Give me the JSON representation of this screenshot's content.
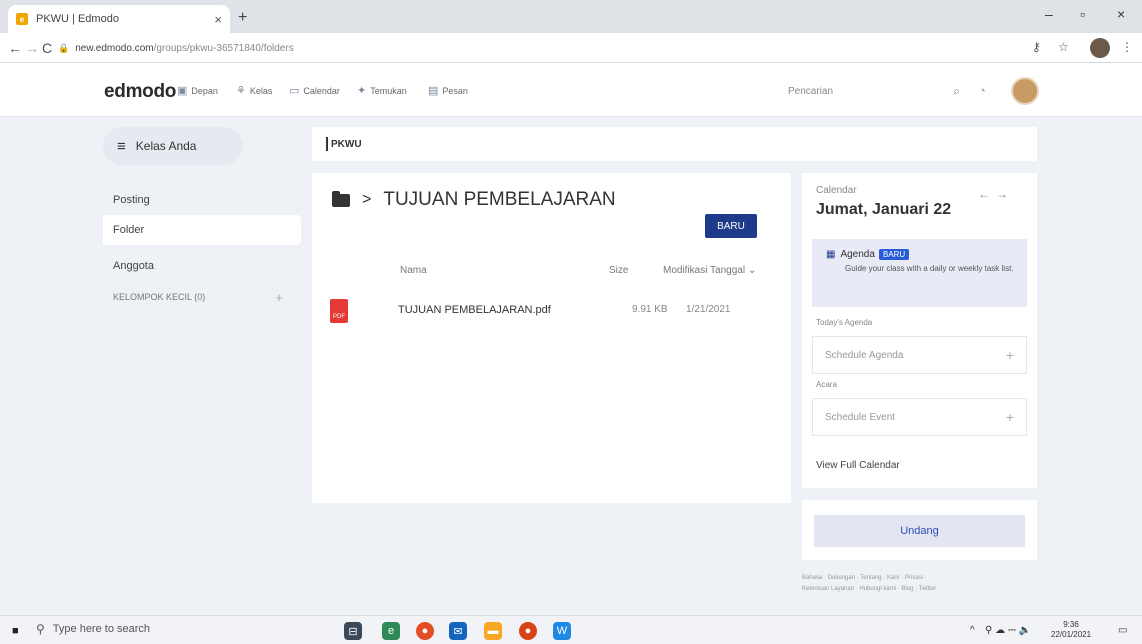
{
  "browser": {
    "tab_title": "PKWU | Edmodo",
    "tab_close": "×",
    "new_tab": "+",
    "url_host": "new.edmodo.com",
    "url_path": "/groups/pkwu-36571840/folders",
    "minimize": "–",
    "maximize": "▫",
    "close": "×",
    "back": "←",
    "forward": "→",
    "reload": "C"
  },
  "header": {
    "logo": "edmodo",
    "nav": [
      {
        "label": "Depan",
        "icon": "home-icon"
      },
      {
        "label": "Kelas",
        "icon": "class-icon"
      },
      {
        "label": "Calendar",
        "icon": "calendar-icon"
      },
      {
        "label": "Temukan",
        "icon": "discover-icon"
      },
      {
        "label": "Pesan",
        "icon": "message-icon"
      }
    ],
    "search_placeholder": "Pencarian"
  },
  "sidebar": {
    "classes_button": "Kelas Anda",
    "items": [
      {
        "label": "Posting"
      },
      {
        "label": "Folder"
      },
      {
        "label": "Anggota"
      }
    ],
    "small_groups": "KELOMPOK KECIL (0)"
  },
  "group": {
    "title": "PKWU"
  },
  "folder": {
    "name": "TUJUAN PEMBELAJARAN",
    "separator": ">",
    "new_button": "BARU",
    "columns": {
      "name": "Nama",
      "size": "Size",
      "modified": "Modifikasi Tanggal ⌄"
    },
    "files": [
      {
        "name": "TUJUAN PEMBELAJARAN.pdf",
        "size": "9.91 KB",
        "date": "1/21/2021"
      }
    ]
  },
  "calendar": {
    "label": "Calendar",
    "date": "Jumat, Januari 22",
    "agenda_title": "Agenda",
    "agenda_badge": "BARU",
    "agenda_desc": "Guide your class with a daily or weekly task list.",
    "today_label": "Today's Agenda",
    "schedule_agenda": "Schedule Agenda",
    "acara_label": "Acara",
    "schedule_event": "Schedule Event",
    "view_full": "View Full Calendar"
  },
  "invite": {
    "button": "Undang"
  },
  "footer": {
    "line1": "Bahasa · Dukungan · Tentang · Karir · Privasi ·",
    "line2": "Ketentuan Layanan · Hubungi kami · Blog · Twitter ·"
  },
  "taskbar": {
    "search_placeholder": "Type here to search",
    "time": "9:36",
    "date": "22/01/2021"
  }
}
